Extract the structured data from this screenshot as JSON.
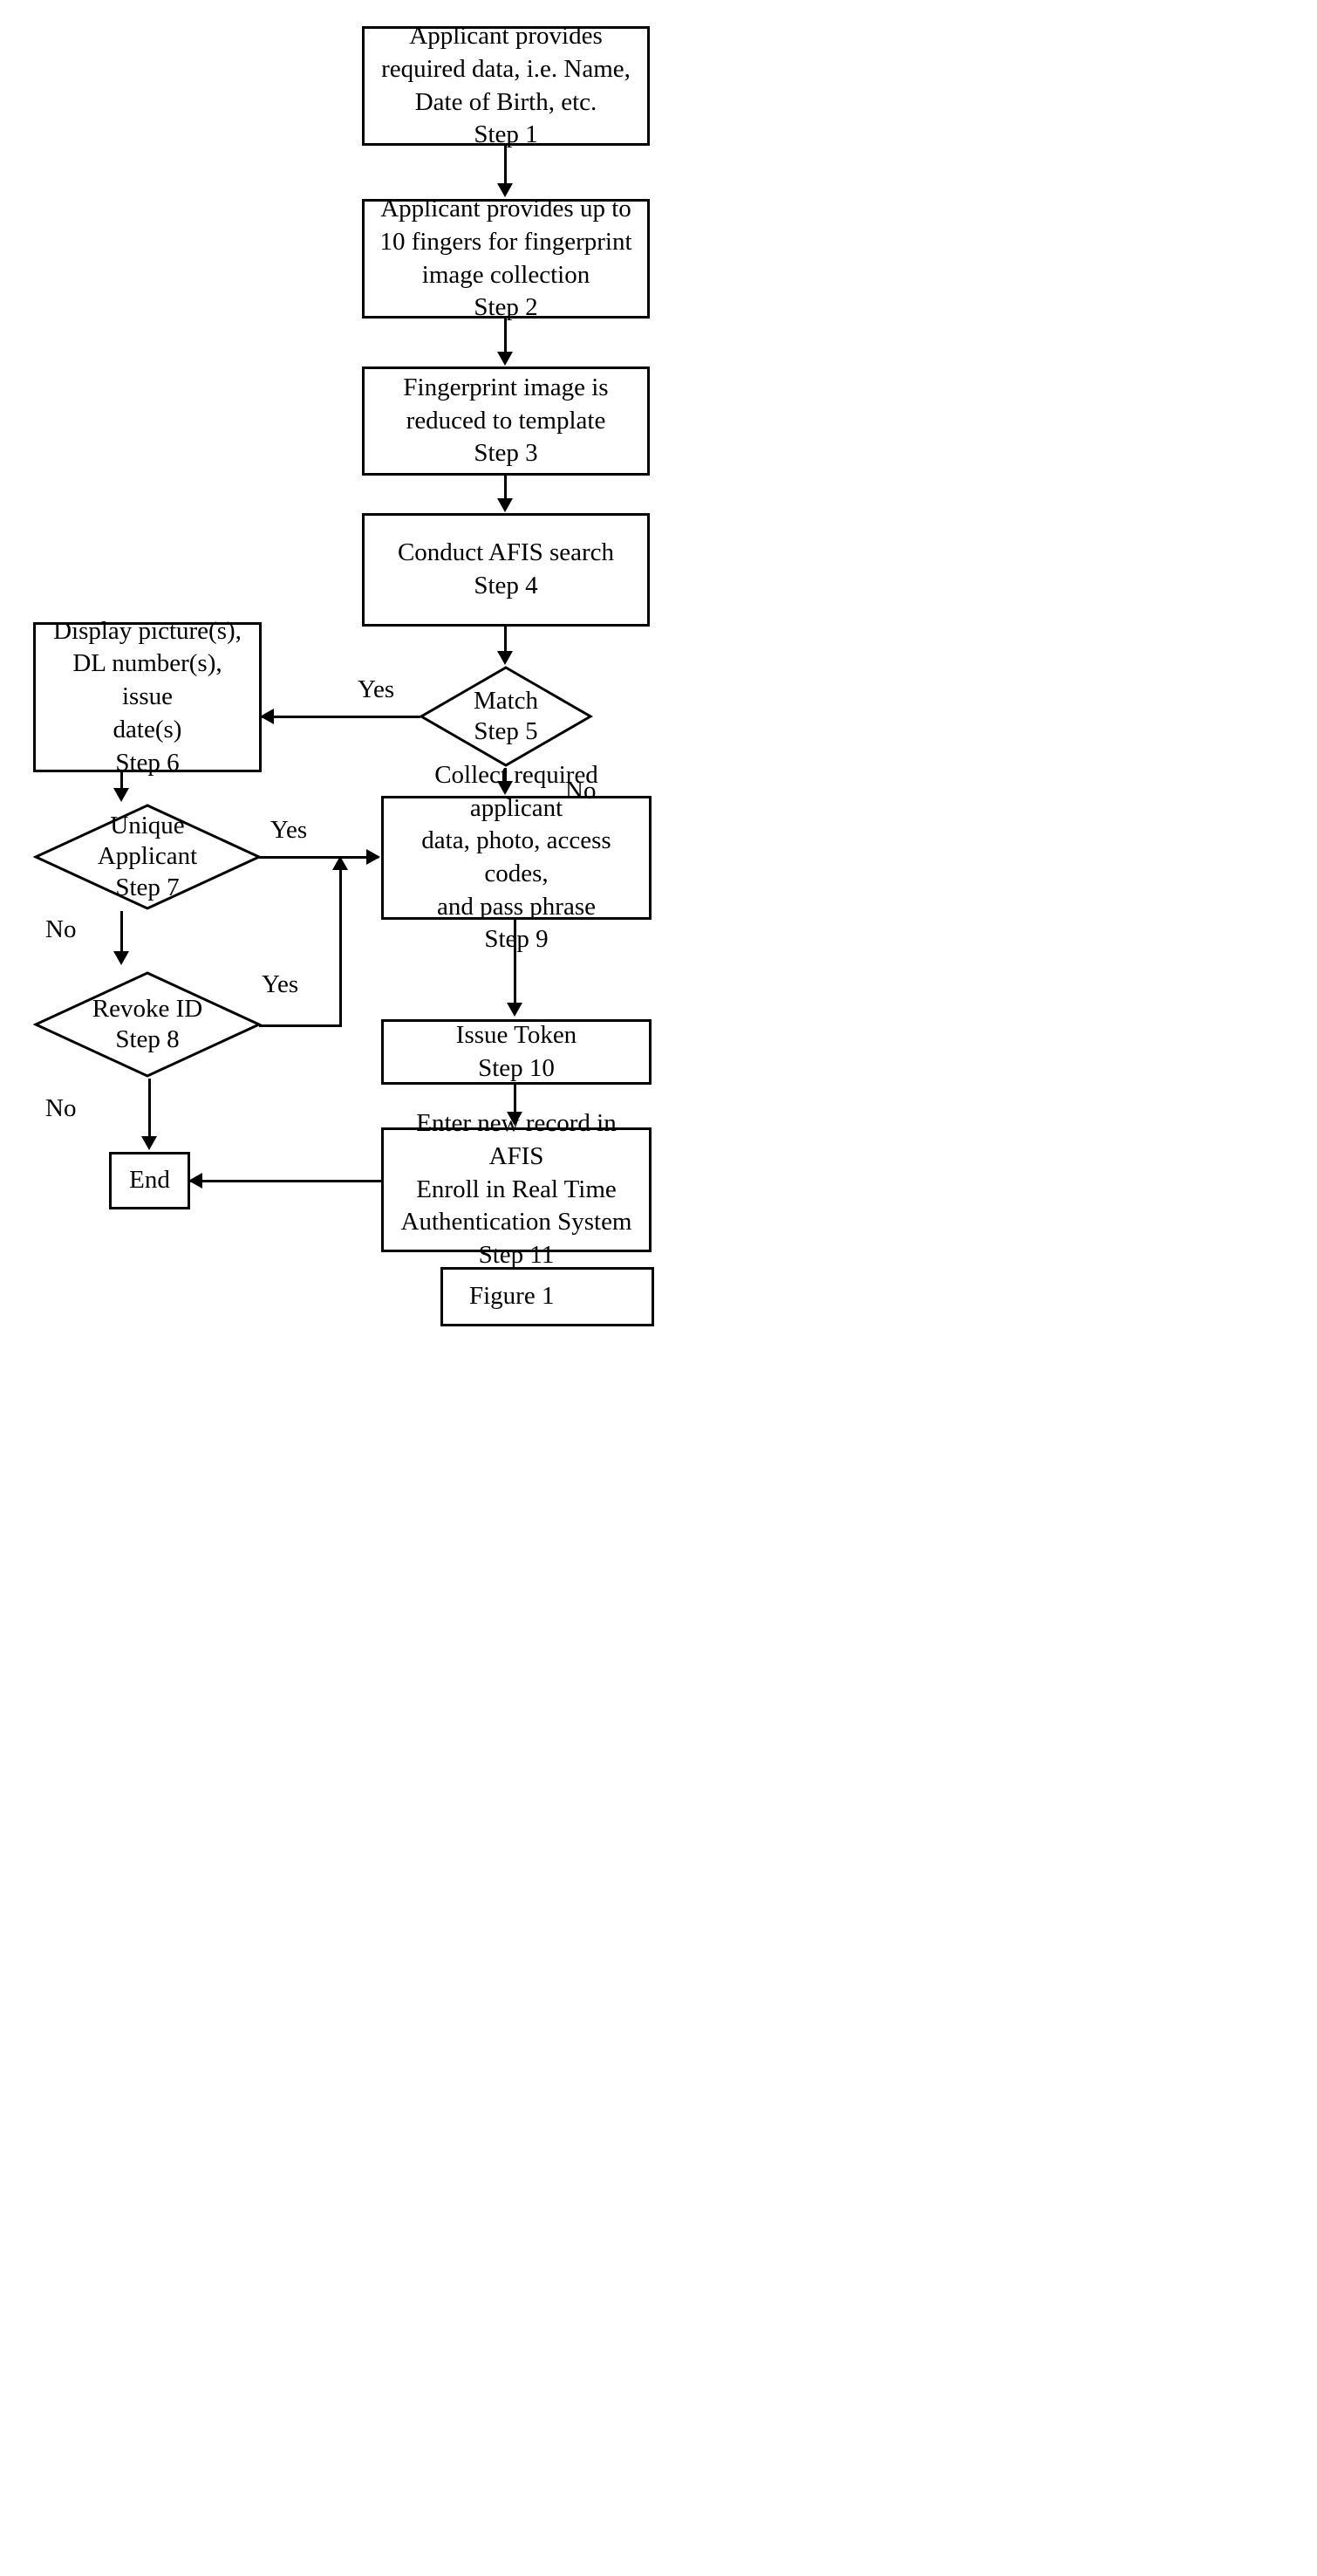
{
  "figure": {
    "caption": "Figure 1"
  },
  "nodes": {
    "step1": {
      "lines": [
        "Applicant provides",
        "required data, i.e. Name,",
        "Date of Birth, etc.",
        "Step 1"
      ]
    },
    "step2": {
      "lines": [
        "Applicant provides up to",
        "10 fingers for fingerprint",
        "image collection",
        "Step 2"
      ]
    },
    "step3": {
      "lines": [
        "Fingerprint image is",
        "reduced to template",
        "Step 3"
      ]
    },
    "step4": {
      "lines": [
        "Conduct AFIS search",
        "Step 4"
      ]
    },
    "step5": {
      "lines": [
        "Match",
        "Step 5"
      ]
    },
    "step6": {
      "lines": [
        "Display picture(s),",
        "DL number(s), issue",
        "date(s)",
        "Step 6"
      ]
    },
    "step7": {
      "lines": [
        "Unique",
        "Applicant",
        "Step 7"
      ]
    },
    "step8": {
      "lines": [
        "Revoke ID",
        "Step 8"
      ]
    },
    "step9": {
      "lines": [
        "Collect required applicant",
        "data, photo, access codes,",
        "and pass phrase",
        "Step 9"
      ]
    },
    "step10": {
      "lines": [
        "Issue Token",
        "Step 10"
      ]
    },
    "step11": {
      "lines": [
        "Enter new record in AFIS",
        "Enroll in Real Time",
        "Authentication System",
        "Step 11"
      ]
    },
    "end": {
      "lines": [
        "End"
      ]
    }
  },
  "edge_labels": {
    "match_yes": "Yes",
    "match_no": "No",
    "unique_yes": "Yes",
    "unique_no": "No",
    "revoke_yes": "Yes",
    "revoke_no": "No"
  },
  "colors": {
    "stroke": "#000000",
    "background": "#ffffff"
  }
}
